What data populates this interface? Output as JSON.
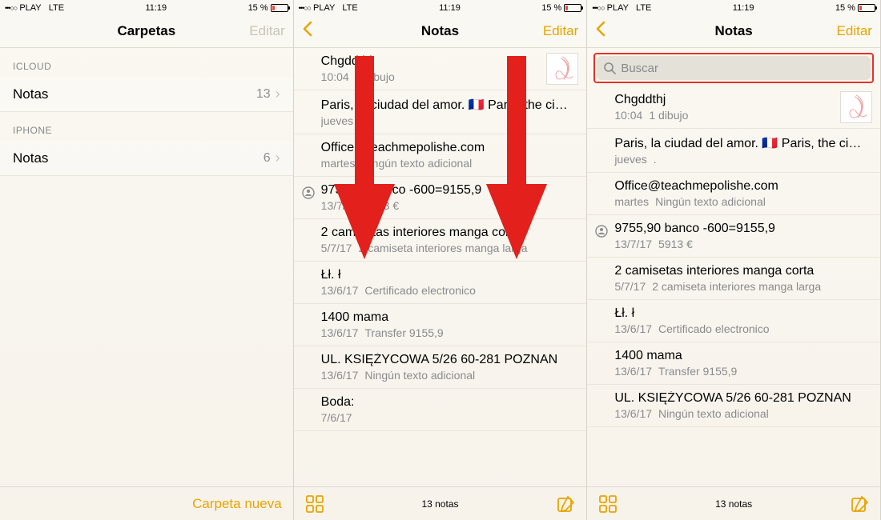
{
  "status": {
    "carrier_dots": "•••○○",
    "carrier": "PLAY",
    "net": "LTE",
    "time": "11:19",
    "battery_pct": "15 %"
  },
  "pane1": {
    "nav_title": "Carpetas",
    "edit": "Editar",
    "groups": [
      {
        "label": "ICLOUD",
        "row_label": "Notas",
        "count": "13"
      },
      {
        "label": "IPHONE",
        "row_label": "Notas",
        "count": "6"
      }
    ],
    "new_folder": "Carpeta nueva"
  },
  "pane2": {
    "nav_title": "Notas",
    "edit": "Editar",
    "toolbar_count": "13 notas",
    "notes": [
      {
        "title": "Chgddthj",
        "date": "10:04",
        "sub": "1 dibujo",
        "thumb": true
      },
      {
        "title": "Paris, la ciudad del amor. 🇫🇷 Paris, the ci…",
        "date": "jueves",
        "sub": "."
      },
      {
        "title": "Office@teachmepolishe.com",
        "date": "martes",
        "sub": "Ningún texto adicional"
      },
      {
        "title": "9755,90 banco -600=9155,9",
        "date": "13/7/17",
        "sub": "5913 €",
        "badge": true
      },
      {
        "title": "2 camisetas interiores manga corta",
        "date": "5/7/17",
        "sub": "2 camiseta interiores manga larga"
      },
      {
        "title": "Łł.          ł",
        "date": "13/6/17",
        "sub": "Certificado electronico"
      },
      {
        "title": "1400 mama",
        "date": "13/6/17",
        "sub": "Transfer 9155,9"
      },
      {
        "title": "UL. KSIĘŻYCOWA 5/26 60-281 POZNAN",
        "date": "13/6/17",
        "sub": "Ningún texto adicional"
      },
      {
        "title": "Boda:",
        "date": "7/6/17",
        "sub": ""
      }
    ]
  },
  "pane3": {
    "nav_title": "Notas",
    "edit": "Editar",
    "toolbar_count": "13 notas",
    "search_placeholder": "Buscar",
    "notes": [
      {
        "title": "Chgddthj",
        "date": "10:04",
        "sub": "1 dibujo",
        "thumb": true
      },
      {
        "title": "Paris, la ciudad del amor. 🇫🇷 Paris, the ci…",
        "date": "jueves",
        "sub": "."
      },
      {
        "title": "Office@teachmepolishe.com",
        "date": "martes",
        "sub": "Ningún texto adicional"
      },
      {
        "title": "9755,90 banco -600=9155,9",
        "date": "13/7/17",
        "sub": "5913 €",
        "badge": true
      },
      {
        "title": "2 camisetas interiores manga corta",
        "date": "5/7/17",
        "sub": "2 camiseta interiores manga larga"
      },
      {
        "title": "Łł.          ł",
        "date": "13/6/17",
        "sub": "Certificado electronico"
      },
      {
        "title": "1400 mama",
        "date": "13/6/17",
        "sub": "Transfer 9155,9"
      },
      {
        "title": "UL. KSIĘŻYCOWA 5/26 60-281 POZNAN",
        "date": "13/6/17",
        "sub": "Ningún texto adicional"
      }
    ]
  }
}
